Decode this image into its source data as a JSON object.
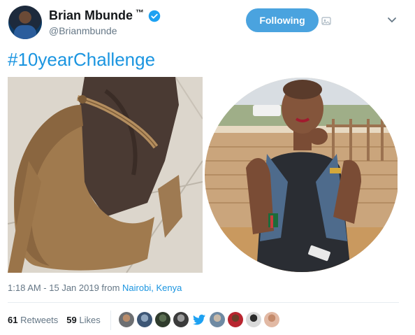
{
  "author": {
    "display_name": "Brian Mbunde",
    "tm": "™",
    "handle": "@Brianmbunde",
    "verified": true,
    "avatar_icon": "user-avatar"
  },
  "follow": {
    "label": "Following"
  },
  "tweet": {
    "text": "#10yearChallenge",
    "hashtag_color": "#1b95e0"
  },
  "media": {
    "left_image": "worn-brown-high-heel-shoe-photo",
    "right_image": "woman-sitting-at-table-circular-photo"
  },
  "meta": {
    "time": "1:18 AM - 15 Jan 2019 from ",
    "location": "Nairobi, Kenya"
  },
  "stats": {
    "retweets_count": "61",
    "retweets_label": "Retweets",
    "likes_count": "59",
    "likes_label": "Likes"
  },
  "likers": [
    "liker-avatar-1",
    "liker-avatar-2",
    "liker-avatar-3",
    "liker-avatar-4",
    "twitter-bird-icon",
    "liker-avatar-6",
    "liker-avatar-7",
    "liker-avatar-8",
    "liker-avatar-9"
  ],
  "colors": {
    "accent": "#1da1f2",
    "follow_button": "#4aa3df",
    "secondary_text": "#657786"
  }
}
